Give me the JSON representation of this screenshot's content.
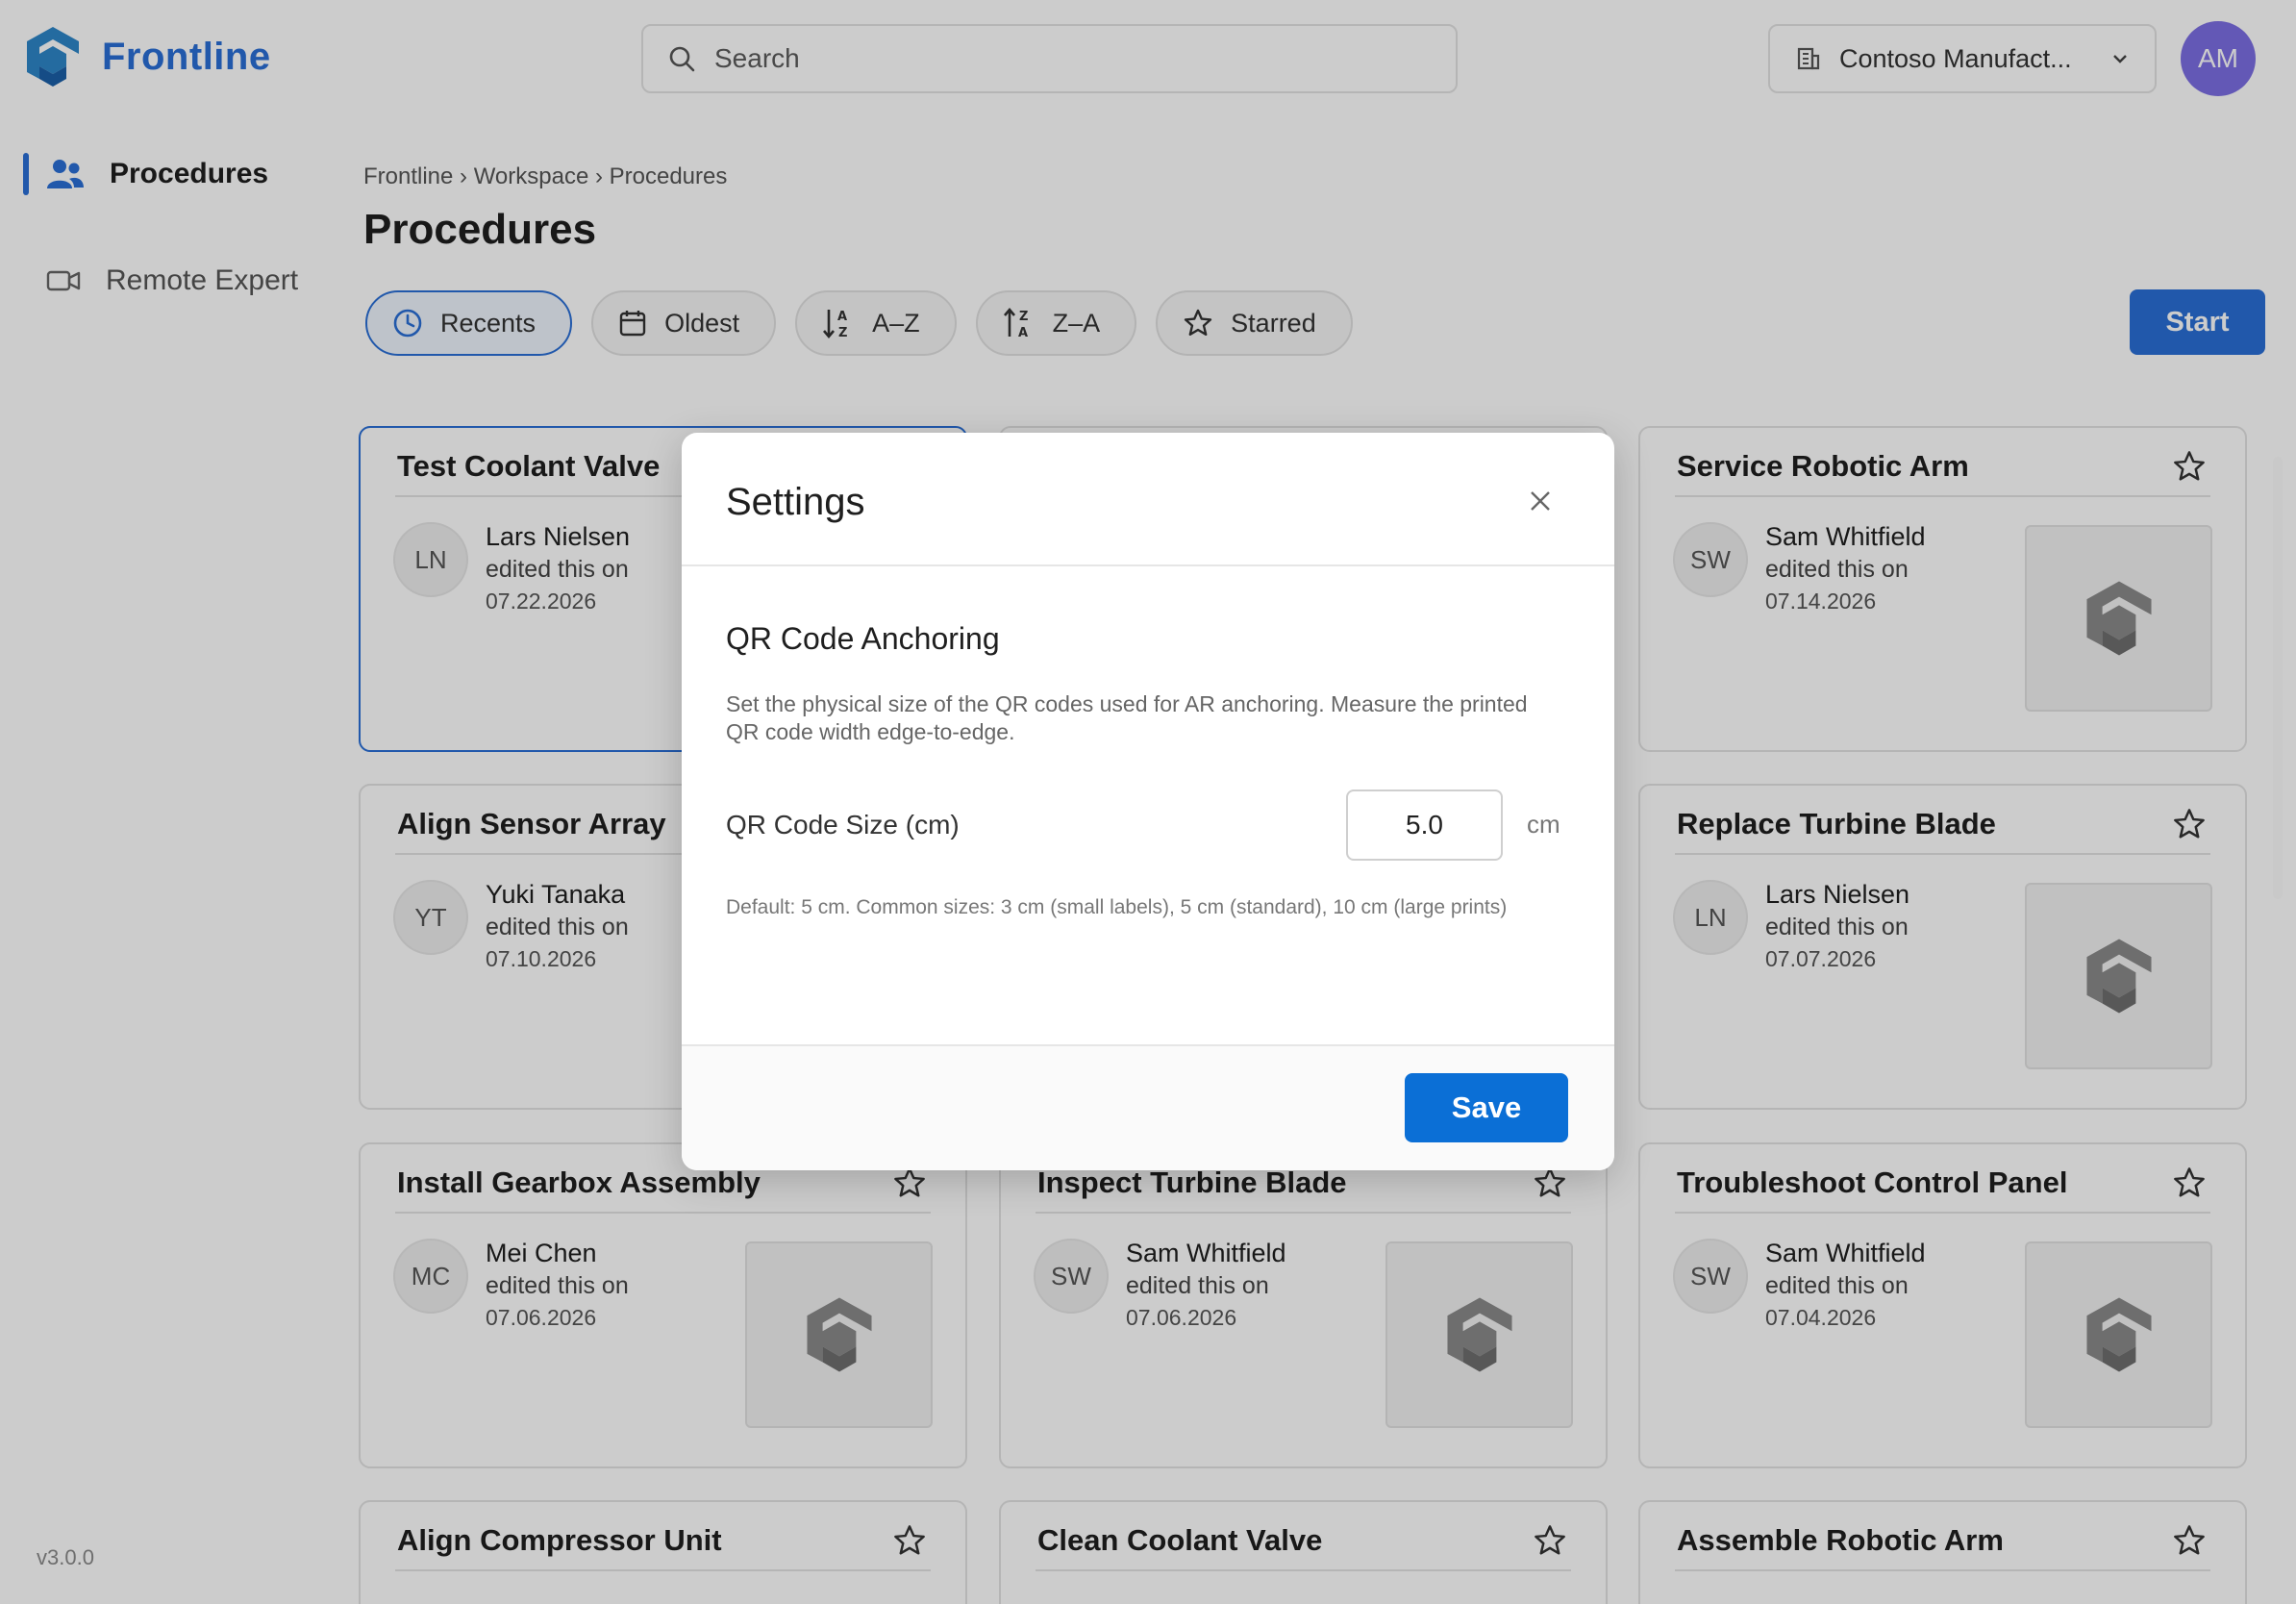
{
  "app": {
    "name": "Frontline",
    "version": "v3.0.0"
  },
  "header": {
    "search_placeholder": "Search",
    "org_name": "Contoso Manufact...",
    "user_initials": "AM"
  },
  "sidebar": {
    "items": [
      {
        "label": "Procedures",
        "icon": "people-icon",
        "active": true
      },
      {
        "label": "Remote Expert",
        "icon": "video-camera-icon",
        "active": false
      }
    ]
  },
  "content": {
    "breadcrumb": "Frontline › Workspace › Procedures",
    "title": "Procedures",
    "filters": [
      {
        "label": "Recents",
        "icon": "clock-icon",
        "active": true
      },
      {
        "label": "Oldest",
        "icon": "calendar-icon",
        "active": false
      },
      {
        "label": "A–Z",
        "icon": "sort-az-icon",
        "active": false
      },
      {
        "label": "Z–A",
        "icon": "sort-za-icon",
        "active": false
      },
      {
        "label": "Starred",
        "icon": "star-icon",
        "active": false
      }
    ],
    "start_label": "Start"
  },
  "cards": [
    {
      "title": "Test Coolant Valve",
      "initials": "LN",
      "author": "Lars Nielsen",
      "edited": "edited this on",
      "date": "07.22.2026"
    },
    {
      "title": "",
      "initials": "",
      "author": "",
      "edited": "",
      "date": ""
    },
    {
      "title": "Service Robotic Arm",
      "initials": "SW",
      "author": "Sam Whitfield",
      "edited": "edited this on",
      "date": "07.14.2026"
    },
    {
      "title": "Align Sensor Array",
      "initials": "YT",
      "author": "Yuki Tanaka",
      "edited": "edited this on",
      "date": "07.10.2026"
    },
    {
      "title": "",
      "initials": "",
      "author": "",
      "edited": "",
      "date": ""
    },
    {
      "title": "Replace Turbine Blade",
      "initials": "LN",
      "author": "Lars Nielsen",
      "edited": "edited this on",
      "date": "07.07.2026"
    },
    {
      "title": "Install Gearbox Assembly",
      "initials": "MC",
      "author": "Mei Chen",
      "edited": "edited this on",
      "date": "07.06.2026"
    },
    {
      "title": "Inspect Turbine Blade",
      "initials": "SW",
      "author": "Sam Whitfield",
      "edited": "edited this on",
      "date": "07.06.2026"
    },
    {
      "title": "Troubleshoot Control Panel",
      "initials": "SW",
      "author": "Sam Whitfield",
      "edited": "edited this on",
      "date": "07.04.2026"
    },
    {
      "title": "Align Compressor Unit"
    },
    {
      "title": "Clean Coolant Valve"
    },
    {
      "title": "Assemble Robotic Arm"
    }
  ],
  "modal": {
    "title": "Settings",
    "section_title": "QR Code Anchoring",
    "description": "Set the physical size of the QR codes used for AR anchoring. Measure the printed QR code width edge-to-edge.",
    "field_label": "QR Code Size (cm)",
    "field_value": "5.0",
    "unit": "cm",
    "help": "Default: 5 cm. Common sizes: 3 cm (small labels), 5 cm (standard), 10 cm (large prints)",
    "save_label": "Save"
  },
  "colors": {
    "accent": "#2a6fd6",
    "avatar": "#7c6fe4",
    "save": "#0b6fd6"
  }
}
